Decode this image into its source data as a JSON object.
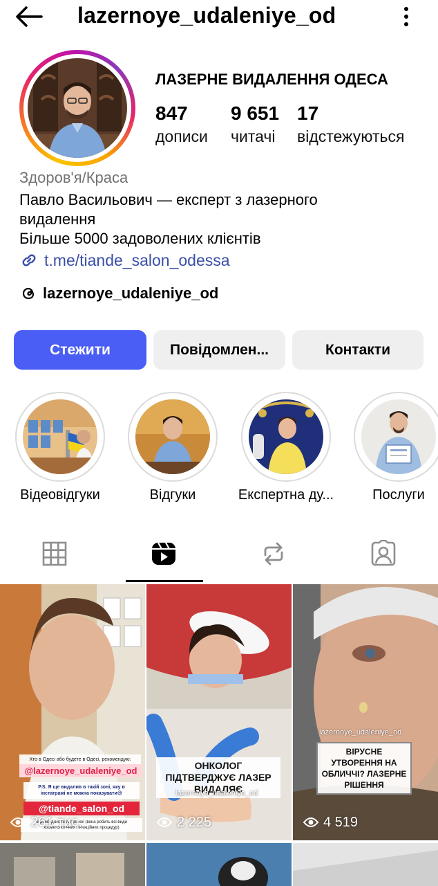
{
  "header": {
    "username": "lazernoye_udaleniye_od",
    "back_icon": "arrow-left-icon",
    "more_icon": "more-vertical-icon"
  },
  "profile": {
    "name": "ЛАЗЕРНЕ ВИДАЛЕННЯ ОДЕСА",
    "stats": [
      {
        "value": "847",
        "label": "дописи"
      },
      {
        "value": "9 651",
        "label": "читачі"
      },
      {
        "value": "17",
        "label": "відстежуються"
      }
    ],
    "category": "Здоров'я/Краса",
    "bio_lines": [
      "Павло Васильович — експерт з лазерного",
      "видалення",
      "Більше 5000 задоволених клієнтів"
    ],
    "link": "t.me/tiande_salon_odessa",
    "threads_handle": "lazernoye_udaleniye_od"
  },
  "actions": {
    "follow": "Стежити",
    "message": "Повідомлен...",
    "contacts": "Контакти"
  },
  "highlights": [
    {
      "label": "Відеовідгуки"
    },
    {
      "label": "Відгуки"
    },
    {
      "label": "Експертна ду..."
    },
    {
      "label": "Послуги"
    }
  ],
  "tabs": [
    {
      "name": "grid-icon"
    },
    {
      "name": "reels-icon",
      "active": true
    },
    {
      "name": "repost-icon"
    },
    {
      "name": "tagged-icon"
    }
  ],
  "posts": [
    {
      "views": "261 тис.",
      "question": "Хто в Одесі або будете в Одесі, рекомендую:",
      "tag1": "@lazernoye_udaleniye_od",
      "ps": "P.S. Я ще видалив в такій зоні, яку в інстаграмі не можна показувати😅",
      "tag2": "@tiande_salon_od",
      "note": "окремо дізнатись про неї (вона робить всі види косметологічних і ін'єкційних процедур)"
    },
    {
      "views": "2 225",
      "caption": "ОНКОЛОГ ПІДТВЕРДЖУЄ ЛАЗЕР ВИДАЛЯЄ",
      "watermark": "lazernoye_udaleniye_od"
    },
    {
      "views": "4 519",
      "caption": "ВІРУСНЕ УТВОРЕННЯ НА ОБЛИЧЧІ? ЛАЗЕРНЕ РІШЕННЯ",
      "watermark": "lazernoye_udaleniye_od"
    }
  ],
  "colors": {
    "primary_button": "#4a5df5",
    "secondary_button": "#efefef",
    "link": "#3a4fa8",
    "category": "#737373"
  }
}
